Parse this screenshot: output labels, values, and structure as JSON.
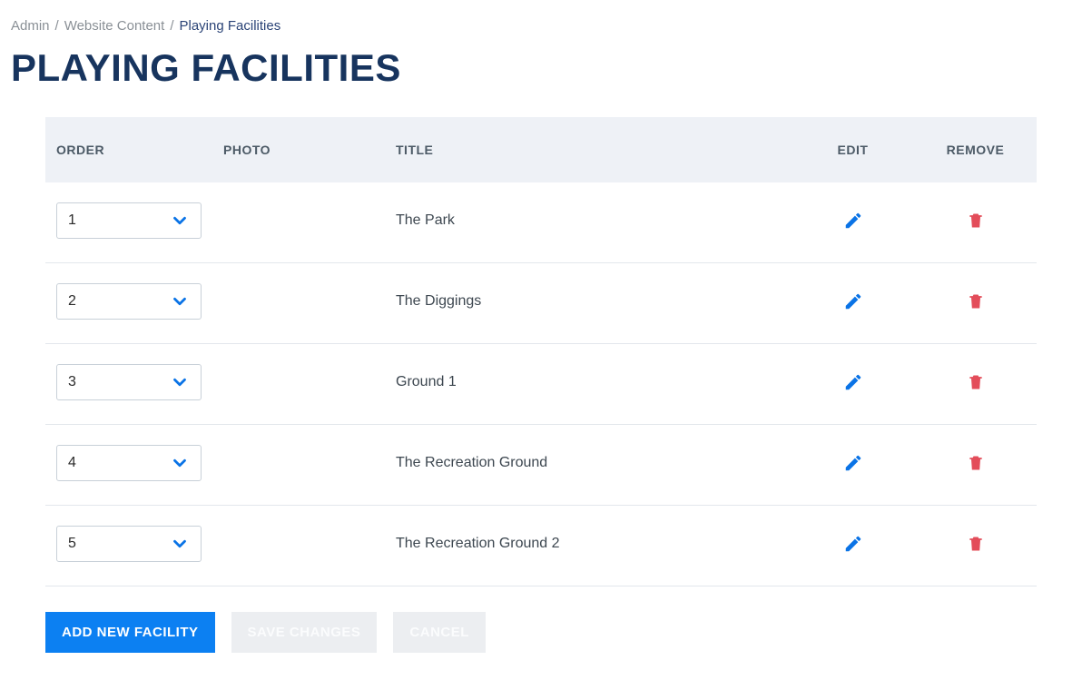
{
  "breadcrumb": {
    "items": [
      {
        "label": "Admin"
      },
      {
        "label": "Website Content"
      }
    ],
    "current": "Playing Facilities"
  },
  "page": {
    "title": "PLAYING FACILITIES"
  },
  "table": {
    "headers": {
      "order": "ORDER",
      "photo": "PHOTO",
      "title": "TITLE",
      "edit": "EDIT",
      "remove": "REMOVE"
    },
    "rows": [
      {
        "order": "1",
        "title": "The Park"
      },
      {
        "order": "2",
        "title": "The Diggings"
      },
      {
        "order": "3",
        "title": "Ground 1"
      },
      {
        "order": "4",
        "title": "The Recreation Ground"
      },
      {
        "order": "5",
        "title": "The Recreation Ground 2"
      }
    ]
  },
  "buttons": {
    "add": "ADD NEW FACILITY",
    "save": "SAVE CHANGES",
    "cancel": "CANCEL"
  }
}
